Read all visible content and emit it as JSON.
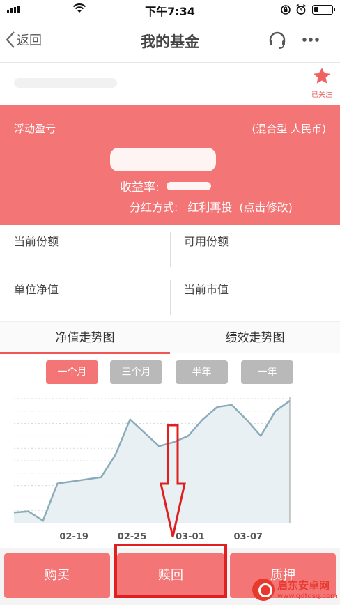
{
  "status_bar": {
    "carrier": "",
    "time": "下午7:34"
  },
  "nav": {
    "back_label": "返回",
    "title": "我的基金"
  },
  "fund": {
    "follow_label": "已关注"
  },
  "profit": {
    "label": "浮动盈亏",
    "fund_type": "(混合型 人民币)",
    "rate_label": "收益率:",
    "dividend_label": "分红方式:",
    "dividend_value": "红利再投",
    "dividend_hint": "(点击修改)"
  },
  "info": {
    "current_shares_label": "当前份额",
    "available_shares_label": "可用份额",
    "unit_nav_label": "单位净值",
    "market_value_label": "当前市值"
  },
  "tabs": [
    {
      "label": "净值走势图",
      "active": true
    },
    {
      "label": "绩效走势图",
      "active": false
    }
  ],
  "ranges": [
    {
      "label": "一个月",
      "active": true
    },
    {
      "label": "三个月",
      "active": false
    },
    {
      "label": "半年",
      "active": false
    },
    {
      "label": "一年",
      "active": false
    }
  ],
  "chart_data": {
    "type": "area",
    "x_tick_labels": [
      "02-19",
      "02-25",
      "03-01",
      "03-07"
    ],
    "values": [
      0.1,
      0.11,
      0.02,
      0.38,
      0.4,
      0.42,
      0.44,
      0.66,
      1.0,
      0.87,
      0.74,
      0.78,
      0.84,
      1.0,
      1.12,
      1.14,
      1.0,
      0.84,
      1.08,
      1.18
    ],
    "y_range": [
      0,
      1.2
    ],
    "grid": true,
    "colors": {
      "line": "#8aabb9",
      "fill": "#e9f0f3",
      "grid": "#cfd8dc"
    }
  },
  "actions": {
    "buy_label": "购买",
    "redeem_label": "赎回",
    "pledge_label": "质押"
  },
  "watermark": {
    "title": "启东安卓网",
    "url": "www.qdtdsq.com"
  },
  "colors": {
    "accent": "#f47575",
    "highlight": "#e02020",
    "inactive": "#b9b9b9"
  }
}
